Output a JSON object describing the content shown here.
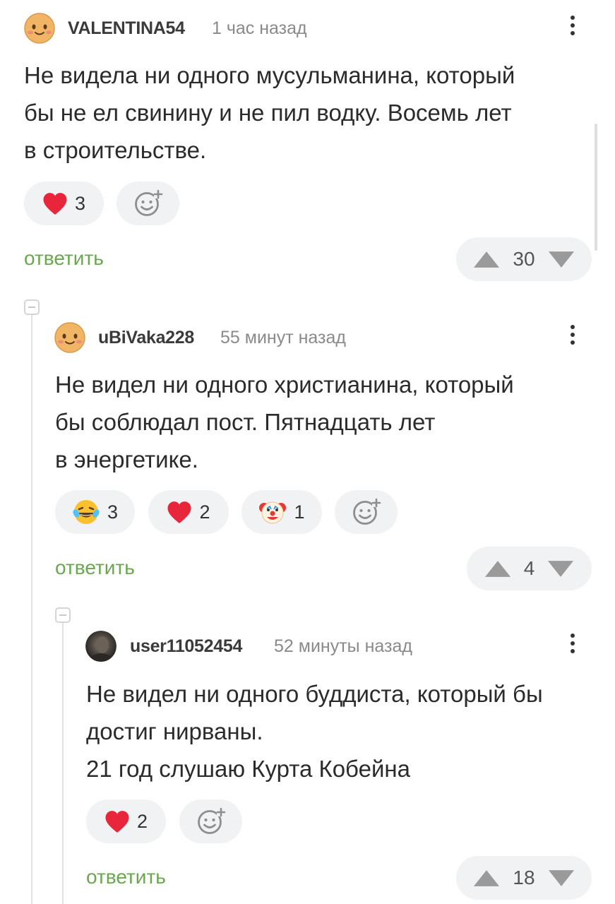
{
  "comments": [
    {
      "username": "VALENTINA54",
      "time": "1 час назад",
      "lines": [
        "Не видела ни одного мусульманина, который",
        "бы не ел свинину и не пил водку. Восемь лет",
        "в строительстве."
      ],
      "reactions": [
        {
          "icon": "heart-icon",
          "count": "3"
        }
      ],
      "reply_label": "ответить",
      "rating": "30"
    },
    {
      "username": "uBiVaka228",
      "time": "55 минут назад",
      "lines": [
        "Не видел ни одного христианина, который",
        "бы соблюдал пост. Пятнадцать лет",
        "в энергетике."
      ],
      "reactions": [
        {
          "icon": "laughing-tears-emoji-icon",
          "count": "3"
        },
        {
          "icon": "heart-icon",
          "count": "2"
        },
        {
          "icon": "clown-emoji-icon",
          "count": "1"
        }
      ],
      "reply_label": "ответить",
      "rating": "4"
    },
    {
      "username": "user11052454",
      "time": "52 минуты назад",
      "lines": [
        "Не видел ни одного буддиста, который бы",
        "достиг нирваны.",
        "21 год слушаю Курта Кобейна"
      ],
      "reactions": [
        {
          "icon": "heart-icon",
          "count": "2"
        }
      ],
      "reply_label": "ответить",
      "rating": "18"
    }
  ],
  "colors": {
    "reply_link": "#6aa84f",
    "pill_bg": "#f1f2f4",
    "heart": "#e8253a",
    "vote_arrow": "#9a9a9a"
  }
}
